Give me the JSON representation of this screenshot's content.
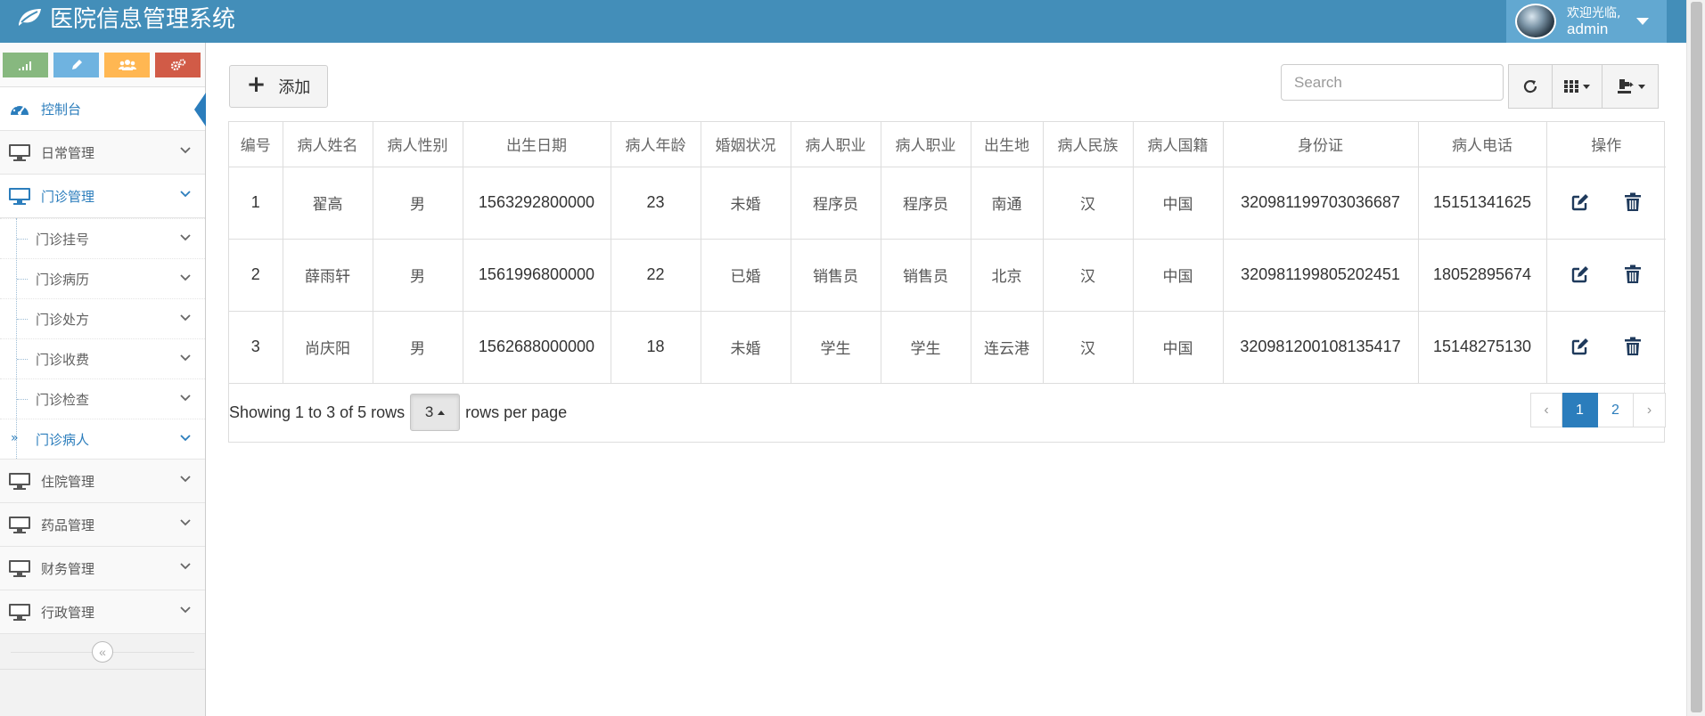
{
  "header": {
    "title": "医院信息管理系统",
    "user": {
      "welcome": "欢迎光临,",
      "name": "admin"
    }
  },
  "sidebar": {
    "shortcuts": [
      "signal-icon",
      "pencil-icon",
      "users-icon",
      "cogs-icon"
    ],
    "dashboard": "控制台",
    "daily": "日常管理",
    "outpatient": "门诊管理",
    "outpatient_items": [
      "门诊挂号",
      "门诊病历",
      "门诊处方",
      "门诊收费",
      "门诊检查",
      "门诊病人"
    ],
    "inpatient": "住院管理",
    "drugs": "药品管理",
    "finance": "财务管理",
    "admin": "行政管理"
  },
  "toolbar": {
    "add_label": "添加",
    "search_placeholder": "Search"
  },
  "table": {
    "headers": [
      "编号",
      "病人姓名",
      "病人性别",
      "出生日期",
      "病人年龄",
      "婚姻状况",
      "病人职业",
      "病人职业",
      "出生地",
      "病人民族",
      "病人国籍",
      "身份证",
      "病人电话",
      "操作"
    ],
    "rows": [
      [
        "1",
        "翟高",
        "男",
        "1563292800000",
        "23",
        "未婚",
        "程序员",
        "程序员",
        "南通",
        "汉",
        "中国",
        "320981199703036687",
        "15151341625"
      ],
      [
        "2",
        "薛雨轩",
        "男",
        "1561996800000",
        "22",
        "已婚",
        "销售员",
        "销售员",
        "北京",
        "汉",
        "中国",
        "320981199805202451",
        "18052895674"
      ],
      [
        "3",
        "尚庆阳",
        "男",
        "1562688000000",
        "18",
        "未婚",
        "学生",
        "学生",
        "连云港",
        "汉",
        "中国",
        "320981200108135417",
        "15148275130"
      ]
    ]
  },
  "pagination": {
    "summary": "Showing 1 to 3 of 5 rows",
    "page_size": "3",
    "per_page_label": "rows per page",
    "prev": "‹",
    "pages": [
      "1",
      "2"
    ],
    "next": "›"
  },
  "colors": {
    "navbar": "#438eb9",
    "accent": "#2b7dbc"
  }
}
